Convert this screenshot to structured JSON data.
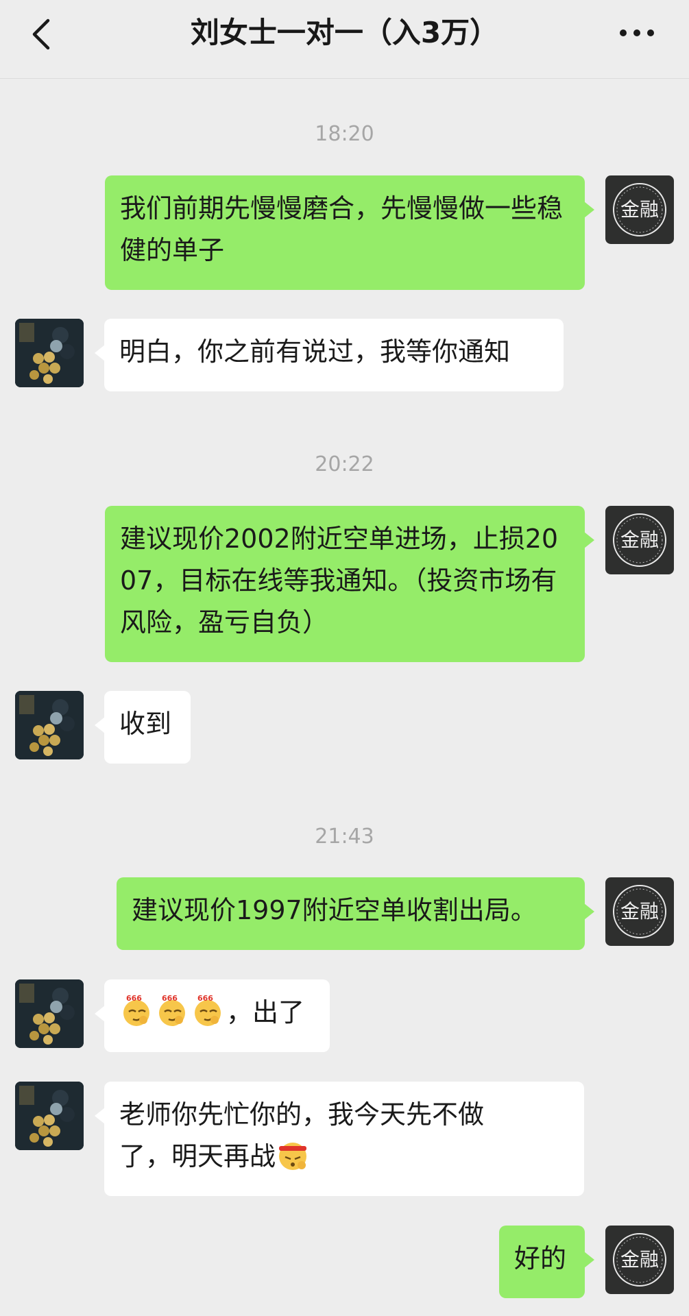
{
  "header": {
    "title": "刘女士一对一（入3万）"
  },
  "self_avatar": {
    "logo_text": "金融"
  },
  "messages": [
    {
      "type": "time",
      "text": "18:20"
    },
    {
      "type": "self",
      "text": "我们前期先慢慢磨合，先慢慢做一些稳健的单子"
    },
    {
      "type": "other",
      "text": "明白，你之前有说过，我等你通知"
    },
    {
      "type": "time",
      "text": "20:22"
    },
    {
      "type": "self",
      "text": "建议现价2002附近空单进场，止损2007，目标在线等我通知。（投资市场有风险，盈亏自负）"
    },
    {
      "type": "other",
      "text": "收到"
    },
    {
      "type": "time",
      "text": "21:43"
    },
    {
      "type": "self",
      "text": "建议现价1997附近空单收割出局。"
    },
    {
      "type": "other",
      "text": "，出了",
      "emoji_prefix": [
        "666-emoji",
        "666-emoji",
        "666-emoji"
      ]
    },
    {
      "type": "other",
      "text_line1": "老师你先忙你的，我今天先不做",
      "text_line2": "了，明天再战",
      "emoji_suffix": "fighting-headband-emoji"
    },
    {
      "type": "self",
      "text": "好的"
    }
  ],
  "colors": {
    "background": "#ededed",
    "self_bubble": "#95ec69",
    "other_bubble": "#ffffff",
    "timestamp": "#a6a6a6"
  }
}
